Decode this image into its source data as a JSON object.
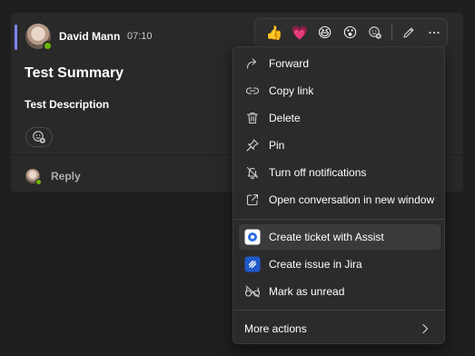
{
  "message": {
    "author": "David Mann",
    "time": "07:10",
    "title": "Test Summary",
    "description": "Test Description",
    "reply_label": "Reply"
  },
  "reactions": [
    {
      "name": "like",
      "glyph": "👍"
    },
    {
      "name": "heart",
      "glyph": "💗"
    },
    {
      "name": "laugh",
      "glyph": "😆"
    },
    {
      "name": "surprised",
      "glyph": "😮"
    }
  ],
  "menu": {
    "items": [
      {
        "label": "Forward",
        "icon": "forward-icon"
      },
      {
        "label": "Copy link",
        "icon": "link-icon"
      },
      {
        "label": "Delete",
        "icon": "trash-icon"
      },
      {
        "label": "Pin",
        "icon": "pin-icon"
      },
      {
        "label": "Turn off notifications",
        "icon": "bell-off-icon"
      },
      {
        "label": "Open conversation in new window",
        "icon": "popout-icon"
      },
      {
        "label": "Create ticket with Assist",
        "icon": "assist-app-icon"
      },
      {
        "label": "Create issue in Jira",
        "icon": "jira-app-icon"
      },
      {
        "label": "Mark as unread",
        "icon": "glasses-icon"
      },
      {
        "label": "More actions",
        "icon": "chevron-right-icon"
      }
    ]
  },
  "colors": {
    "accent": "#7f85f5",
    "presence": "#6bb700",
    "assist_blue": "#2f6fe0",
    "jira_blue": "#1f59c9"
  }
}
